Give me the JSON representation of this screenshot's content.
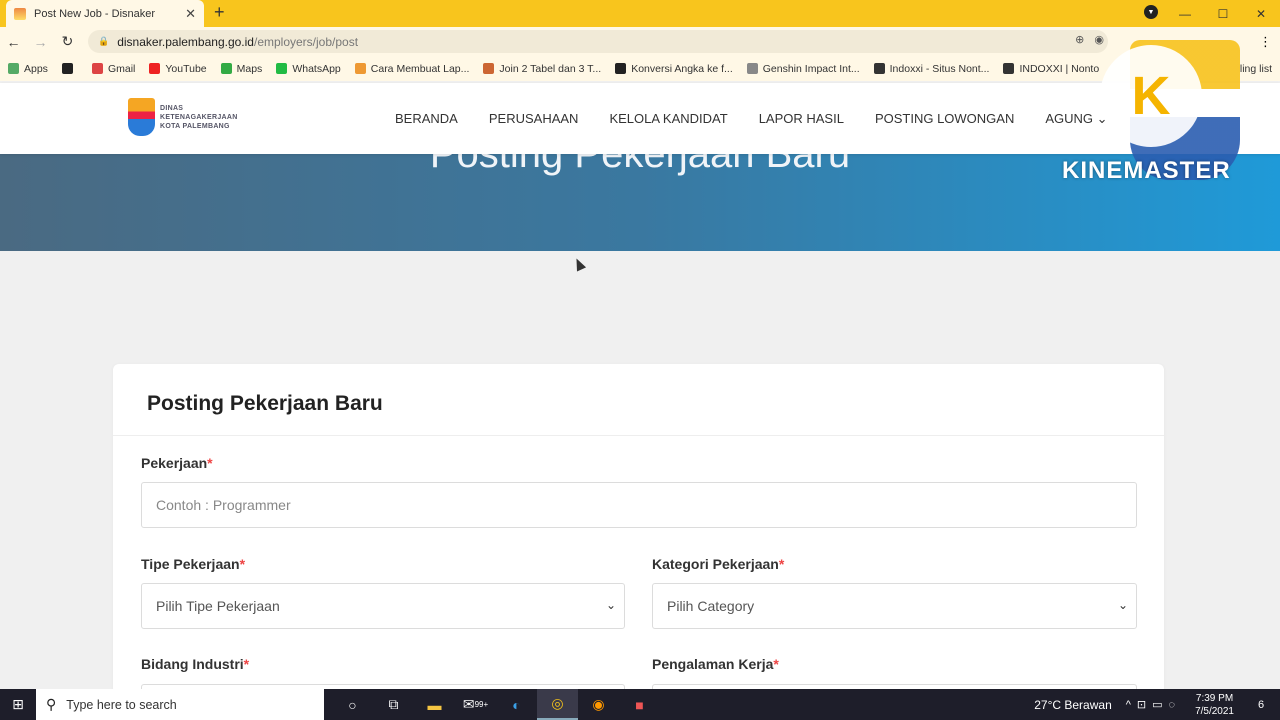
{
  "browser": {
    "tab_title": "Post New Job - Disnaker",
    "tab_close": "✕",
    "new_tab": "+",
    "url_host": "disnaker.palembang.go.id",
    "url_path": "/employers/job/post",
    "bookmarks": [
      {
        "label": "Apps",
        "color": "#5a6"
      },
      {
        "label": "",
        "color": "#222"
      },
      {
        "label": "Gmail",
        "color": "#d44"
      },
      {
        "label": "YouTube",
        "color": "#e22"
      },
      {
        "label": "Maps",
        "color": "#3a4"
      },
      {
        "label": "WhatsApp",
        "color": "#2b4"
      },
      {
        "label": "Cara Membuat Lap...",
        "color": "#e93"
      },
      {
        "label": "Join 2 Tabel dan 3 T...",
        "color": "#c63"
      },
      {
        "label": "Konversi Angka ke f...",
        "color": "#222"
      },
      {
        "label": "Genshin Impact Int...",
        "color": "#888"
      },
      {
        "label": "Indoxxi - Situs Nont...",
        "color": "#333"
      },
      {
        "label": "INDOXXI | Nonto",
        "color": "#333"
      }
    ],
    "bookmark_tail": "ling list"
  },
  "site": {
    "logo_lines": [
      "DINAS",
      "KETENAGAKERJAAN",
      "KOTA PALEMBANG"
    ],
    "nav": [
      "BERANDA",
      "PERUSAHAAN",
      "KELOLA KANDIDAT",
      "LAPOR HASIL",
      "POSTING LOWONGAN",
      "AGUNG ⌄"
    ],
    "hero_title": "Posting Pekerjaan Baru"
  },
  "watermark": {
    "letter": "K",
    "text": "KINEMASTER"
  },
  "form": {
    "title": "Posting Pekerjaan Baru",
    "job_label": "Pekerjaan",
    "job_placeholder": "Contoh : Programmer",
    "type_label": "Tipe Pekerjaan",
    "type_value": "Pilih Tipe Pekerjaan",
    "category_label": "Kategori Pekerjaan",
    "category_value": "Pilih Category",
    "industry_label": "Bidang Industri",
    "experience_label": "Pengalaman Kerja",
    "required_mark": "*"
  },
  "taskbar": {
    "search_placeholder": "Type here to search",
    "weather": "27°C  Berawan",
    "time": "7:39 PM",
    "date": "7/5/2021",
    "notifications": "6",
    "mail_badge": "99+"
  }
}
